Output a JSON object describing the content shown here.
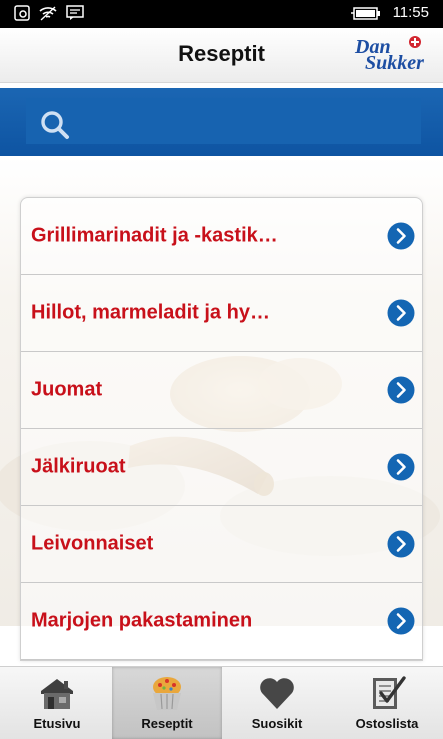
{
  "status_bar": {
    "time": "11:55",
    "icons": [
      "screen-lock-icon",
      "wifi-icon",
      "message-icon",
      "battery-icon"
    ]
  },
  "header": {
    "title": "Reseptit",
    "logo": {
      "line1": "Dan",
      "line2": "Sukker"
    }
  },
  "search": {
    "value": "",
    "placeholder": ""
  },
  "categories": [
    {
      "label": "Grillimarinadit ja -kastik…"
    },
    {
      "label": "Hillot, marmeladit ja hy…"
    },
    {
      "label": "Juomat"
    },
    {
      "label": "Jälkiruoat"
    },
    {
      "label": "Leivonnaiset"
    },
    {
      "label": "Marjojen pakastaminen"
    }
  ],
  "bottom_nav": {
    "items": [
      {
        "label": "Etusivu",
        "icon": "house-icon",
        "active": false
      },
      {
        "label": "Reseptit",
        "icon": "cupcake-icon",
        "active": true
      },
      {
        "label": "Suosikit",
        "icon": "heart-icon",
        "active": false
      },
      {
        "label": "Ostoslista",
        "icon": "checklist-icon",
        "active": false
      }
    ]
  },
  "colors": {
    "accent_red": "#c8101a",
    "search_blue": "#1466b3",
    "chevron_blue": "#1466b3",
    "brand_blue": "#1d4ea3"
  }
}
